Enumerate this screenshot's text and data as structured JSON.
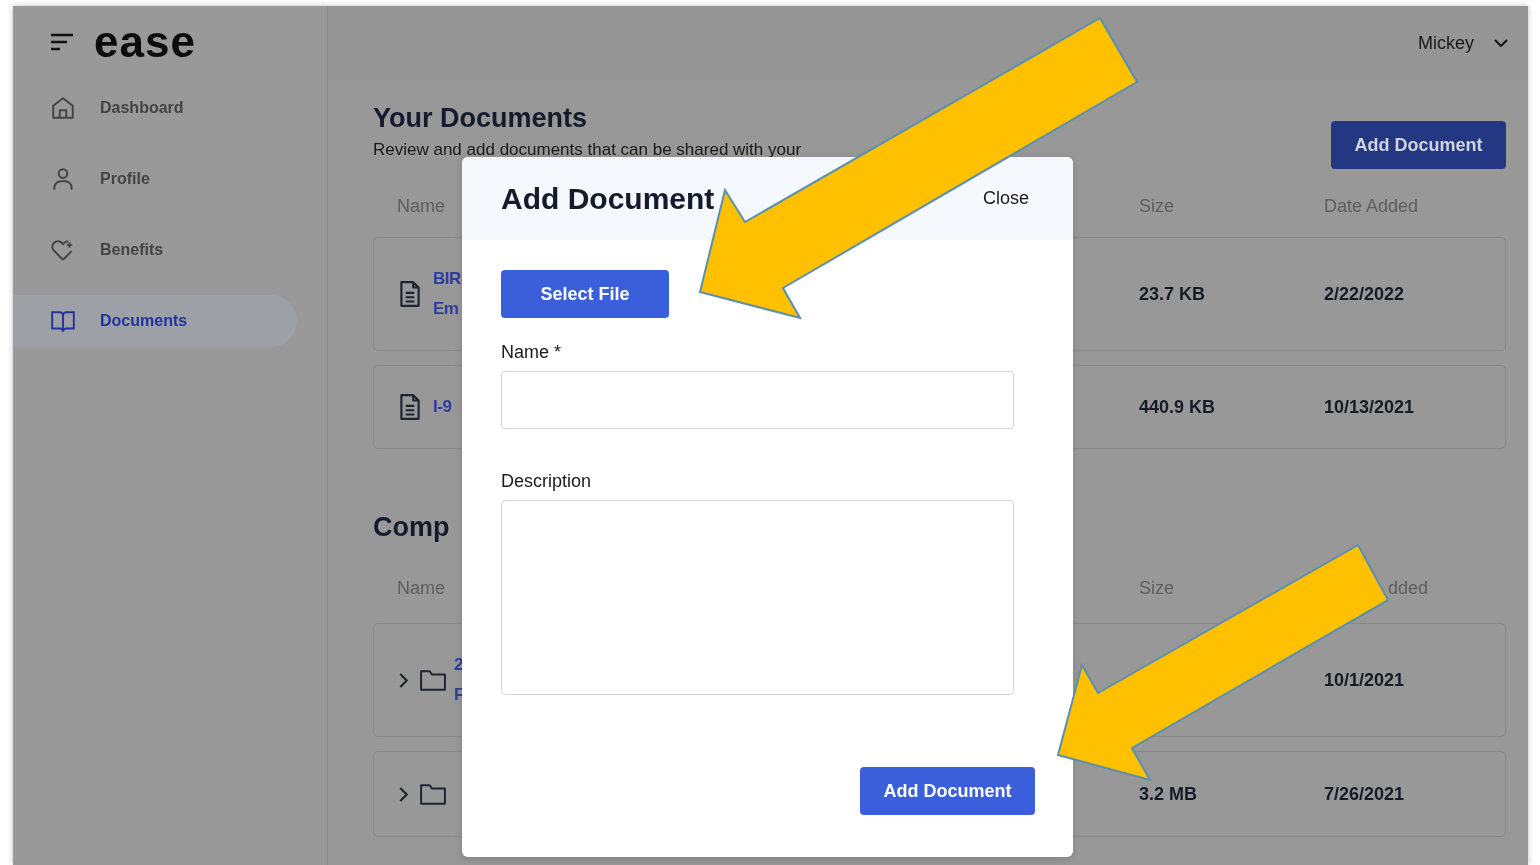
{
  "header": {
    "logo": "ease",
    "user": "Mickey"
  },
  "sidebar": {
    "items": [
      {
        "label": "Dashboard",
        "kind": "home",
        "selected": false
      },
      {
        "label": "Profile",
        "kind": "person",
        "selected": false
      },
      {
        "label": "Benefits",
        "kind": "heart",
        "selected": false
      },
      {
        "label": "Documents",
        "kind": "book",
        "selected": true
      }
    ]
  },
  "your_documents": {
    "title": "Your Documents",
    "subtitle": "Review and add documents that can be shared with your",
    "add_button": "Add Document",
    "columns": [
      "Name",
      "Size",
      "Date Added"
    ],
    "rows": [
      {
        "kind": "file",
        "name": [
          "BIR",
          "Em"
        ],
        "size": "23.7 KB",
        "date": "2/22/2022"
      },
      {
        "kind": "file",
        "name": [
          "I-9"
        ],
        "size": "440.9 KB",
        "date": "10/13/2021"
      }
    ]
  },
  "company_documents": {
    "title": "Comp",
    "columns": [
      "Name",
      "Size",
      "dded"
    ],
    "rows": [
      {
        "kind": "folder",
        "expanded": false,
        "name": [
          "2",
          "F"
        ],
        "date": "10/1/2021"
      },
      {
        "kind": "folder",
        "expanded": false,
        "size": "3.2 MB",
        "date": "7/26/2021"
      }
    ]
  },
  "modal": {
    "title": "Add Document",
    "close": "Close",
    "select_button": "Select File",
    "fields": [
      {
        "label": "Name *",
        "kind": "input"
      },
      {
        "label": "Description",
        "kind": "textarea"
      }
    ],
    "submit": "Add Document"
  }
}
